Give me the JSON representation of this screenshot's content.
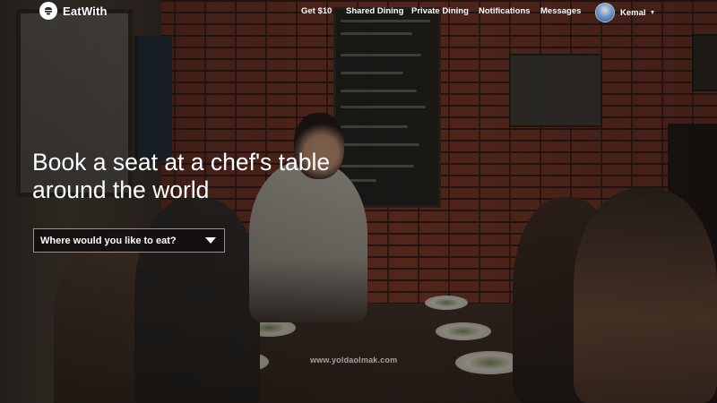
{
  "brand": {
    "name": "EatWith",
    "icon": "eatwith-logo-icon"
  },
  "nav": {
    "links": [
      {
        "label": "Get $10"
      },
      {
        "label": "Shared Dining"
      },
      {
        "label": "Private Dining"
      },
      {
        "label": "Notifications"
      },
      {
        "label": "Messages"
      }
    ],
    "user": {
      "name": "Kemal",
      "icon": "chevron-down-icon"
    }
  },
  "hero": {
    "headline_line1": "Book a seat at a chef's table",
    "headline_line2": "around the world",
    "search": {
      "value": "Where would you like to eat?",
      "icon": "caret-down-icon"
    }
  },
  "watermark": "www.yoldaolmak.com",
  "colors": {
    "text": "#ffffff",
    "brick": "#7a3626",
    "overlay": "#0f0c0a"
  }
}
